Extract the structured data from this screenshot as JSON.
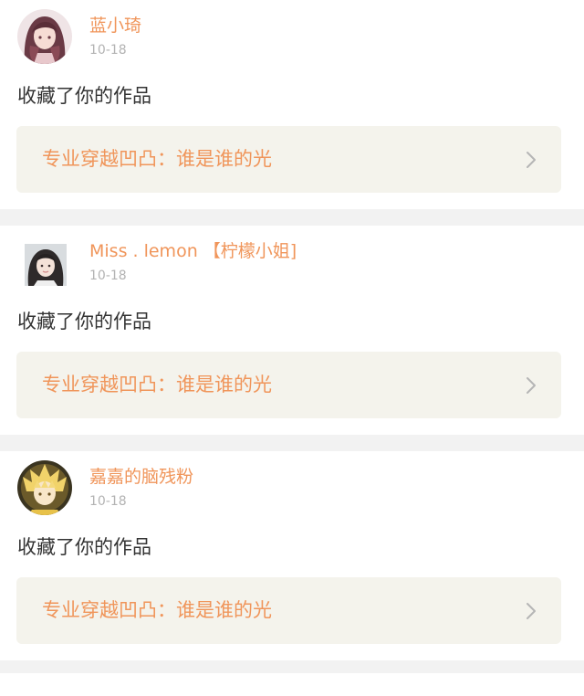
{
  "colors": {
    "accent": "#f0955a",
    "card_bg": "#f4f3ec",
    "separator": "#f2f2f2",
    "date_text": "#b3b3b3",
    "body_text": "#333333"
  },
  "notifications": [
    {
      "username": "蓝小琦",
      "date": "10-18",
      "action": "收藏了你的作品",
      "work_title": "专业穿越凹凸：谁是谁的光",
      "avatar_icon": "avatar-anime-girl-pink"
    },
    {
      "username": "Miss . lemon 【柠檬小姐]",
      "date": "10-18",
      "action": "收藏了你的作品",
      "work_title": "专业穿越凹凸：谁是谁的光",
      "avatar_icon": "avatar-girl-photo"
    },
    {
      "username": "嘉嘉的脑残粉",
      "date": "10-18",
      "action": "收藏了你的作品",
      "work_title": "专业穿越凹凸：谁是谁的光",
      "avatar_icon": "avatar-anime-boy-blonde"
    }
  ]
}
